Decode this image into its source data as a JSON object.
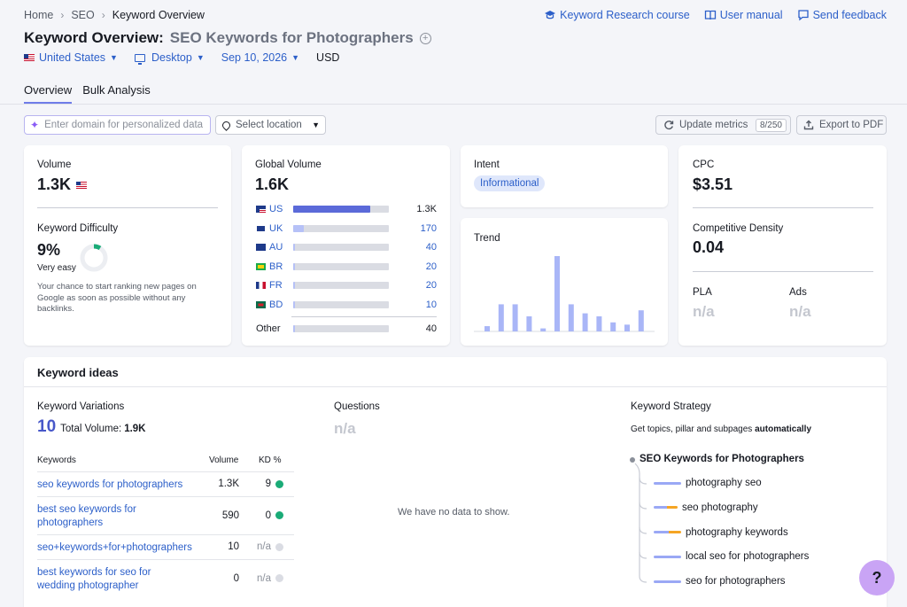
{
  "breadcrumb": {
    "items": [
      "Home",
      "SEO",
      "Keyword Overview"
    ]
  },
  "top_links": {
    "course": "Keyword Research course",
    "manual": "User manual",
    "feedback": "Send feedback"
  },
  "header": {
    "title": "Keyword Overview:",
    "keyword": "SEO Keywords for Photographers"
  },
  "filters": {
    "country": "United States",
    "device": "Desktop",
    "date": "Sep 10, 2026",
    "currency": "USD"
  },
  "tabs": [
    "Overview",
    "Bulk Analysis"
  ],
  "toolbar": {
    "domain_placeholder": "Enter domain for personalized data",
    "location_placeholder": "Select location",
    "update_label": "Update metrics",
    "update_count": "8/250",
    "export_label": "Export to PDF"
  },
  "volume": {
    "label": "Volume",
    "value": "1.3K"
  },
  "difficulty": {
    "label": "Keyword Difficulty",
    "value": "9%",
    "level": "Very easy",
    "percent": 9,
    "desc": "Your chance to start ranking new pages on Google as soon as possible without any backlinks."
  },
  "global_volume": {
    "label": "Global Volume",
    "value": "1.6K",
    "rows": [
      {
        "code": "US",
        "value": "1.3K",
        "share": 0.81,
        "color": "#5b6ad9"
      },
      {
        "code": "UK",
        "value": "170",
        "share": 0.11,
        "color": "#b6c1f7"
      },
      {
        "code": "AU",
        "value": "40",
        "share": 0.02,
        "color": "#b6c1f7"
      },
      {
        "code": "BR",
        "value": "20",
        "share": 0.01,
        "color": "#b6c1f7"
      },
      {
        "code": "FR",
        "value": "20",
        "share": 0.01,
        "color": "#b6c1f7"
      },
      {
        "code": "BD",
        "value": "10",
        "share": 0.01,
        "color": "#b6c1f7"
      }
    ],
    "other_label": "Other",
    "other_value": "40",
    "other_share": 0.02
  },
  "intent": {
    "label": "Intent",
    "value": "Informational"
  },
  "trend": {
    "label": "Trend",
    "values": [
      0.07,
      0.36,
      0.36,
      0.2,
      0.04,
      1.0,
      0.36,
      0.24,
      0.2,
      0.12,
      0.09,
      0.28
    ],
    "color": "#a9b6f7"
  },
  "cpc": {
    "label": "CPC",
    "value": "$3.51"
  },
  "density": {
    "label": "Competitive Density",
    "value": "0.04"
  },
  "pla": {
    "label": "PLA",
    "value": "n/a"
  },
  "ads": {
    "label": "Ads",
    "value": "n/a"
  },
  "keyword_ideas": {
    "title": "Keyword ideas",
    "variations": {
      "label": "Keyword Variations",
      "count": "10",
      "total_label": "Total Volume:",
      "total_value": "1.9K",
      "headers": {
        "keyword": "Keywords",
        "volume": "Volume",
        "kd": "KD %"
      },
      "rows": [
        {
          "keyword": "seo keywords for photographers",
          "volume": "1.3K",
          "kd": "9",
          "dot": "#1aab77"
        },
        {
          "keyword": "best seo keywords for photographers",
          "volume": "590",
          "kd": "0",
          "dot": "#1aab77"
        },
        {
          "keyword": "seo+keywords+for+photographers",
          "volume": "10",
          "kd": "n/a",
          "dot": "#dadce3"
        },
        {
          "keyword": "best keywords for seo for wedding photographer",
          "volume": "0",
          "kd": "n/a",
          "dot": "#dadce3"
        }
      ]
    },
    "questions": {
      "label": "Questions",
      "value": "n/a",
      "empty": "We have no data to show."
    },
    "strategy": {
      "label": "Keyword Strategy",
      "desc": "Get topics, pillar and subpages",
      "desc_bold": "automatically",
      "root": "SEO Keywords for Photographers",
      "items": [
        {
          "label": "photography seo",
          "accent": ""
        },
        {
          "label": "seo photography",
          "accent": "#f5a524"
        },
        {
          "label": "photography keywords",
          "accent": "#f5a524"
        },
        {
          "label": "local seo for photographers",
          "accent": ""
        },
        {
          "label": "seo for photographers",
          "accent": ""
        }
      ]
    }
  },
  "help": {
    "label": "?"
  }
}
